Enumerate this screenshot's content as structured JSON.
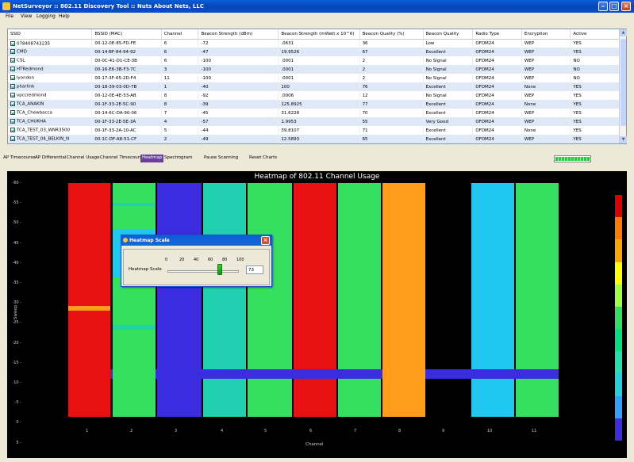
{
  "window": {
    "title": "NetSurveyor :: 802.11 Discovery Tool :: Nuts About Nets, LLC"
  },
  "menu": [
    "File",
    "View",
    "Logging",
    "Help"
  ],
  "table": {
    "headers": [
      "SSID",
      "BSSID (MAC)",
      "Channel",
      "Beacon Strength (dBm)",
      "Beacon Strength (mWatt x 10^6)",
      "Beacon Quality (%)",
      "Beacon Quality",
      "Radio Type",
      "Encryption",
      "Active"
    ],
    "rows": [
      [
        "078408743235",
        "00-12-0E-85-FD-FE",
        "6",
        "-72",
        ".0631",
        "36",
        "Low",
        "OFDM24",
        "WEP",
        "YES"
      ],
      [
        "CMD",
        "00-14-BF-84-94-92",
        "6",
        "-47",
        "19.9526",
        "67",
        "Excellent",
        "OFDM24",
        "WEP",
        "YES"
      ],
      [
        "CSL",
        "00-0C-41-D1-CE-3B",
        "6",
        "-100",
        ".0001",
        "2",
        "No Signal",
        "OFDM24",
        "WEP",
        "NO"
      ],
      [
        "HTRedmond",
        "00-16-E6-3B-F3-7C",
        "3",
        "-100",
        ".0001",
        "2",
        "No Signal",
        "OFDM24",
        "WEP",
        "NO"
      ],
      [
        "lyondon",
        "00-17-3F-65-2D-F4",
        "11",
        "-100",
        ".0001",
        "2",
        "No Signal",
        "OFDM24",
        "WEP",
        "NO"
      ],
      [
        "pharlink",
        "00-18-39-03-0D-7B",
        "1",
        "-40",
        "100",
        "76",
        "Excellent",
        "OFDM24",
        "None",
        "YES"
      ],
      [
        "vpccredmond",
        "00-12-0E-4E-53-AB",
        "8",
        "-92",
        ".0006",
        "12",
        "No Signal",
        "OFDM24",
        "WEP",
        "YES"
      ],
      [
        "TCA_ANAKIN",
        "00-1F-33-2E-5C-90",
        "8",
        "-39",
        "125.8925",
        "77",
        "Excellent",
        "OFDM24",
        "None",
        "YES"
      ],
      [
        "TCA_Chewbacca",
        "00-14-6C-DA-90-06",
        "7",
        "-45",
        "31.6228",
        "70",
        "Excellent",
        "OFDM24",
        "WEP",
        "YES"
      ],
      [
        "TCA_CHUKHA",
        "00-1F-33-2E-5E-3A",
        "4",
        "-57",
        "1.9953",
        "55",
        "Very Good",
        "OFDM24",
        "WEP",
        "YES"
      ],
      [
        "TCA_TEST_03_WNR3500",
        "00-1F-33-2A-10-AC",
        "5",
        "-44",
        "39.8107",
        "71",
        "Excellent",
        "OFDM24",
        "None",
        "YES"
      ],
      [
        "TCA_TEST_04_BELKIN_N",
        "00-1C-DF-A8-51-CF",
        "2",
        "-49",
        "12.5893",
        "65",
        "Excellent",
        "OFDM24",
        "WEP",
        "YES"
      ]
    ]
  },
  "toolbar": {
    "tabs": [
      "AP Timecourse",
      "AP Differential",
      "Channel Usage",
      "Channel Timecourse",
      "Heatmap",
      "Spectrogram",
      "Pause Scanning",
      "Reset Charts"
    ],
    "active_tab": "Heatmap"
  },
  "chart_data": {
    "type": "heatmap",
    "title": "Heatmap of 802.11 Channel Usage",
    "xlabel": "Channel",
    "ylabel": "Sweep",
    "x_ticks": [
      "1",
      "2",
      "3",
      "4",
      "5",
      "6",
      "7",
      "8",
      "9",
      "10",
      "11"
    ],
    "y_ticks": [
      "-60",
      "-55",
      "-50",
      "-45",
      "-40",
      "-35",
      "-30",
      "-25",
      "-20",
      "-15",
      "-10",
      "-5",
      "0",
      "5"
    ],
    "legend_colors": [
      "#e00000",
      "#ff7a00",
      "#ffa500",
      "#ffff00",
      "#a0ff40",
      "#30e060",
      "#00e080",
      "#20e0b0",
      "#20d0e0",
      "#30a0ff",
      "#3a2de0"
    ]
  },
  "dialog": {
    "title": "Heatmap Scale",
    "label": "Heatmap Scale",
    "ticks": [
      "0",
      "20",
      "40",
      "60",
      "80",
      "100"
    ],
    "value": "73",
    "slider_value": 73
  }
}
